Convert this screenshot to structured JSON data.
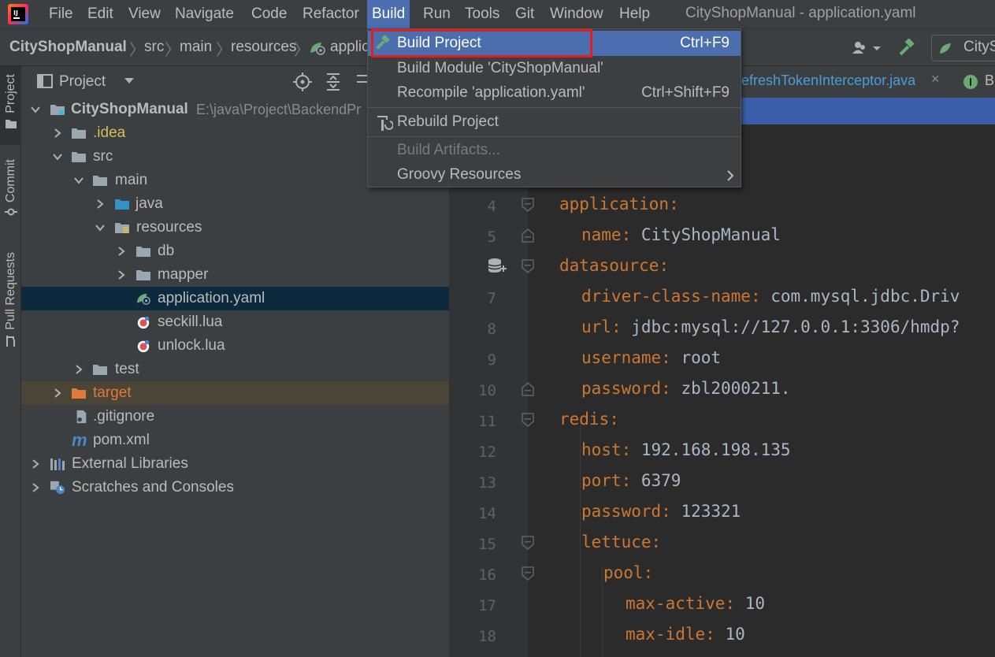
{
  "window_title": "CityShopManual - application.yaml",
  "menu": [
    "File",
    "Edit",
    "View",
    "Navigate",
    "Code",
    "Refactor",
    "Build",
    "Run",
    "Tools",
    "Git",
    "Window",
    "Help"
  ],
  "active_menu": "Build",
  "breadcrumb": [
    "CityShopManual",
    "src",
    "main",
    "resources",
    "applic"
  ],
  "navbar_right": {
    "run_config": "CitySh"
  },
  "tool_tabs": [
    "Project",
    "Commit",
    "Pull Requests"
  ],
  "project_panel": {
    "title": "Project",
    "tree": [
      {
        "label": "CityShopManual",
        "path": "E:\\java\\Project\\BackendPr",
        "icon": "module-folder-icon"
      },
      {
        "label": ".idea",
        "icon": "folder-icon"
      },
      {
        "label": "src",
        "icon": "folder-icon"
      },
      {
        "label": "main",
        "icon": "folder-icon"
      },
      {
        "label": "java",
        "icon": "source-folder-icon"
      },
      {
        "label": "resources",
        "icon": "resources-folder-icon"
      },
      {
        "label": "db",
        "icon": "folder-icon"
      },
      {
        "label": "mapper",
        "icon": "folder-icon"
      },
      {
        "label": "application.yaml",
        "icon": "spring-yaml-icon"
      },
      {
        "label": "seckill.lua",
        "icon": "lua-file-icon"
      },
      {
        "label": "unlock.lua",
        "icon": "lua-file-icon"
      },
      {
        "label": "test",
        "icon": "folder-icon"
      },
      {
        "label": "target",
        "icon": "excluded-folder-icon"
      },
      {
        "label": ".gitignore",
        "icon": "gitignore-icon"
      },
      {
        "label": "pom.xml",
        "icon": "maven-icon"
      },
      {
        "label": "External Libraries",
        "icon": "libraries-icon"
      },
      {
        "label": "Scratches and Consoles",
        "icon": "scratches-icon"
      }
    ]
  },
  "editor": {
    "tabs": [
      {
        "label": "efreshTokenInterceptor.java"
      },
      {
        "label": "B"
      }
    ],
    "lines": [
      {
        "n": "4",
        "key": "application",
        "sep": ":",
        "val": ""
      },
      {
        "n": "5",
        "key": "name",
        "sep": ": ",
        "val": "CityShopManual"
      },
      {
        "n": "6",
        "key": "datasource",
        "sep": ":",
        "val": ""
      },
      {
        "n": "7",
        "key": "driver-class-name",
        "sep": ": ",
        "val": "com.mysql.jdbc.Driv"
      },
      {
        "n": "8",
        "key": "url",
        "sep": ": ",
        "val": "jdbc:mysql://127.0.0.1:3306/hmdp?"
      },
      {
        "n": "9",
        "key": "username",
        "sep": ": ",
        "val": "root"
      },
      {
        "n": "10",
        "key": "password",
        "sep": ": ",
        "val": "zbl2000211."
      },
      {
        "n": "11",
        "key": "redis",
        "sep": ":",
        "val": ""
      },
      {
        "n": "12",
        "key": "host",
        "sep": ": ",
        "val": "192.168.198.135"
      },
      {
        "n": "13",
        "key": "port",
        "sep": ": ",
        "val": "6379"
      },
      {
        "n": "14",
        "key": "password",
        "sep": ": ",
        "val": "123321"
      },
      {
        "n": "15",
        "key": "lettuce",
        "sep": ":",
        "val": ""
      },
      {
        "n": "16",
        "key": "pool",
        "sep": ":",
        "val": ""
      },
      {
        "n": "17",
        "key": "max-active",
        "sep": ": ",
        "val": "10"
      },
      {
        "n": "18",
        "key": "max-idle",
        "sep": ": ",
        "val": "10"
      }
    ]
  },
  "build_menu": {
    "items": [
      {
        "label": "Build Project",
        "shortcut": "Ctrl+F9"
      },
      {
        "label": "Build Module 'CityShopManual'",
        "shortcut": ""
      },
      {
        "label": "Recompile 'application.yaml'",
        "shortcut": "Ctrl+Shift+F9"
      },
      {
        "label": "Rebuild Project",
        "shortcut": ""
      },
      {
        "label": "Build Artifacts...",
        "shortcut": ""
      },
      {
        "label": "Groovy Resources",
        "shortcut": ""
      }
    ]
  }
}
